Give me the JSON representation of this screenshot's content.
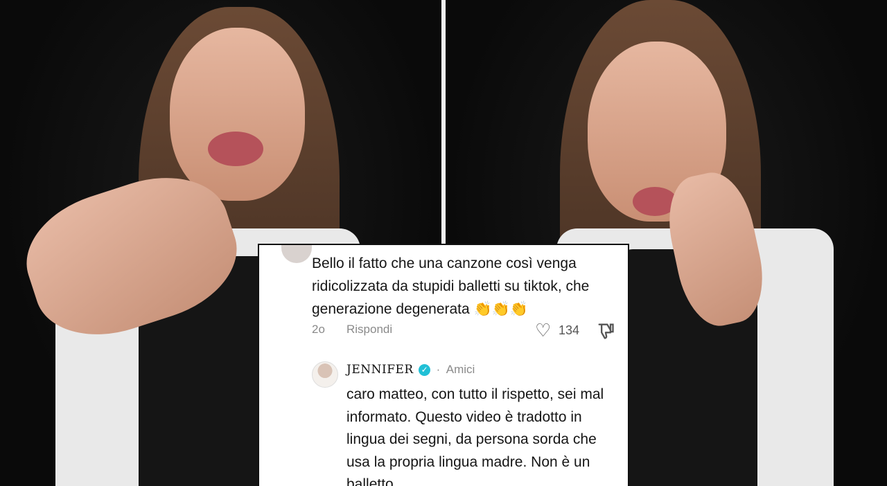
{
  "comment": {
    "text": "Bello il fatto che una canzone così venga ridicolizzata da stupidi balletti su tiktok, che generazione degenerata 👏👏👏",
    "time": "2o",
    "reply_label": "Rispondi",
    "like_count": "134"
  },
  "reply": {
    "author": "JENNIFER",
    "separator": "·",
    "relation": "Amici",
    "text": "caro matteo, con tutto il rispetto, sei mal informato. Questo video è tradotto in lingua dei segni, da persona sorda che usa la propria lingua madre. Non è un balletto."
  },
  "icons": {
    "heart": "heart-outline-icon",
    "dislike": "thumbs-down-icon",
    "verified": "verified-check-icon"
  },
  "colors": {
    "verified_badge": "#21c0d6",
    "muted_text": "#8a8a8a"
  }
}
